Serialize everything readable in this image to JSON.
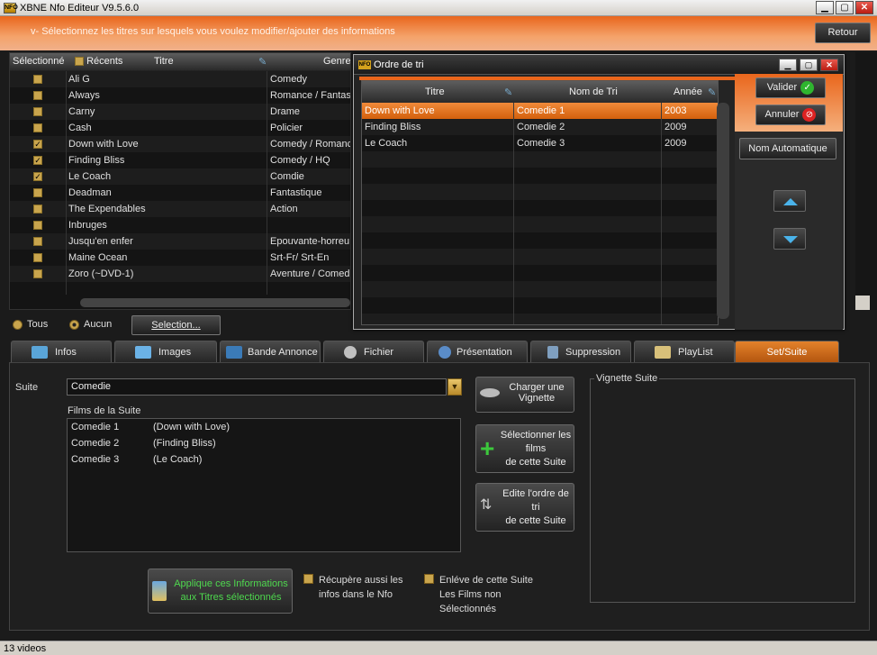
{
  "window": {
    "title": "XBNE Nfo Editeur V9.5.6.0",
    "icon_text": "NFO",
    "minimize": "▁",
    "maximize": "▢",
    "close": "✕"
  },
  "banner": {
    "message": "v- Sélectionnez les titres sur lesquels vous voulez modifier/ajouter des informations",
    "retour": "Retour"
  },
  "list": {
    "headers": {
      "selectionne": "Sélectionné",
      "recents": "Récents",
      "titre": "Titre",
      "genre": "Genre"
    },
    "rows": [
      {
        "checked": false,
        "title": "Ali G",
        "genre": "Comedy"
      },
      {
        "checked": false,
        "title": "Always",
        "genre": "Romance  /  Fantas"
      },
      {
        "checked": false,
        "title": "Carny",
        "genre": "Drame"
      },
      {
        "checked": false,
        "title": "Cash",
        "genre": "Policier"
      },
      {
        "checked": true,
        "title": "Down with Love",
        "genre": "Comedy  /  Romance"
      },
      {
        "checked": true,
        "title": "Finding Bliss",
        "genre": "Comedy  /  HQ"
      },
      {
        "checked": true,
        "title": "Le Coach",
        "genre": "Comdie"
      },
      {
        "checked": false,
        "title": "Deadman",
        "genre": "Fantastique"
      },
      {
        "checked": false,
        "title": "The Expendables",
        "genre": "Action"
      },
      {
        "checked": false,
        "title": "Inbruges",
        "genre": ""
      },
      {
        "checked": false,
        "title": "Jusqu'en enfer",
        "genre": "Epouvante-horreu"
      },
      {
        "checked": false,
        "title": "Maine Ocean",
        "genre": "Srt-Fr/ Srt-En"
      },
      {
        "checked": false,
        "title": "Zoro (~DVD-1)",
        "genre": "Aventure  /  Comed"
      }
    ],
    "check_mark": "✓"
  },
  "selection": {
    "tous": "Tous",
    "aucun": "Aucun",
    "selection_btn": "Selection..."
  },
  "tabs": [
    {
      "label": "Infos",
      "color": "#5aa5d8"
    },
    {
      "label": "Images",
      "color": "#6bb2e6"
    },
    {
      "label": "Bande Annonce",
      "color": "#3b7bb8"
    },
    {
      "label": "Fichier",
      "color": "#c0c0c0"
    },
    {
      "label": "Présentation",
      "color": "#5a8cc8"
    },
    {
      "label": "Suppression",
      "color": "#7f9fbf"
    },
    {
      "label": "PlayList",
      "color": "#d8c07a"
    },
    {
      "label": "Set/Suite",
      "color": "#e3822b"
    }
  ],
  "suite_panel": {
    "suite_label": "Suite",
    "suite_value": "Comedie",
    "dropdown_glyph": "▼",
    "films_label": "Films de la Suite",
    "films": [
      {
        "name": "Comedie 1",
        "title": "(Down with Love)"
      },
      {
        "name": "Comedie 2",
        "title": "(Finding Bliss)"
      },
      {
        "name": "Comedie 3",
        "title": "(Le Coach)"
      }
    ],
    "charger_line1": "Charger une",
    "charger_line2": "Vignette",
    "selectionner_line1": "Sélectionner les",
    "selectionner_line2": "films",
    "selectionner_line3": "de cette Suite",
    "edite_line1": "Edite l'ordre de",
    "edite_line2": "tri",
    "edite_line3": "de cette Suite",
    "vignette_label": "Vignette Suite",
    "applique_line1": "Applique ces Informations",
    "applique_line2": "aux Titres sélectionnés",
    "recupere_line1": "Récupère aussi les",
    "recupere_line2": "infos dans le Nfo",
    "enleve_line1": "Enléve de cette Suite",
    "enleve_line2": "Les Films non",
    "enleve_line3": "Sélectionnés"
  },
  "status": {
    "text": "13 videos"
  },
  "dialog": {
    "title": "Ordre de tri",
    "icon_text": "NFO",
    "headers": {
      "titre": "Titre",
      "nom_de_tri": "Nom de Tri",
      "annee": "Année"
    },
    "rows": [
      {
        "titre": "Down with Love",
        "nom": "Comedie 1",
        "annee": "2003",
        "selected": true
      },
      {
        "titre": "Finding Bliss",
        "nom": "Comedie 2",
        "annee": "2009",
        "selected": false
      },
      {
        "titre": "Le Coach",
        "nom": "Comedie 3",
        "annee": "2009",
        "selected": false
      }
    ],
    "valider": "Valider",
    "annuler": "Annuler",
    "nom_auto": "Nom Automatique",
    "ok_glyph": "✓",
    "no_glyph": "⊘"
  }
}
